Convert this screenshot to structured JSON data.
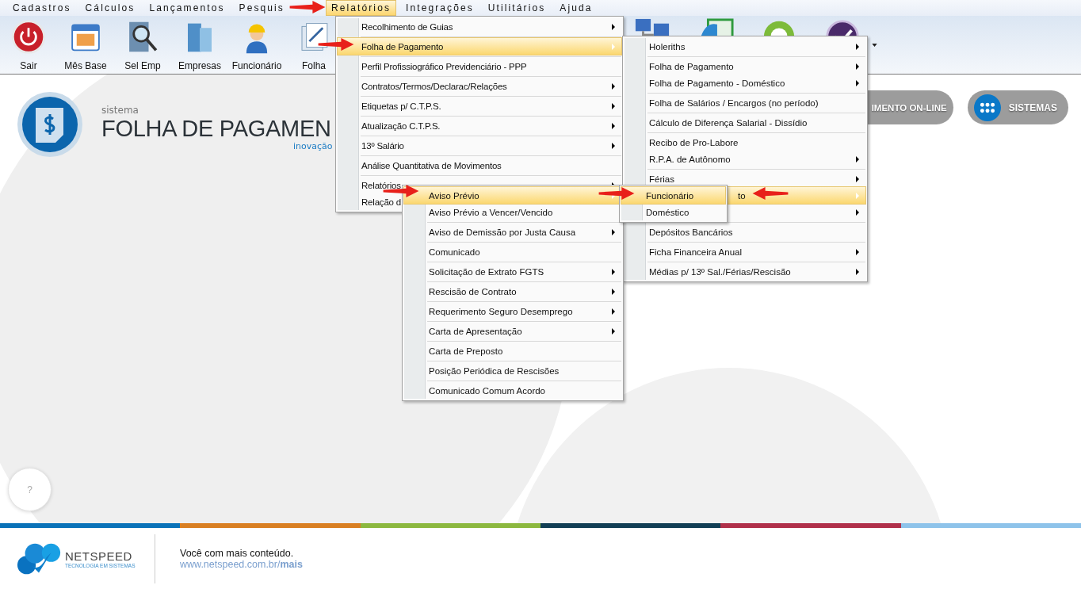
{
  "menu_bar": [
    {
      "label": "Cadastros",
      "selected": false
    },
    {
      "label": "Cálculos",
      "selected": false
    },
    {
      "label": "Lançamentos",
      "selected": false
    },
    {
      "label": "Pesquis",
      "selected": false
    },
    {
      "label": "Relatórios",
      "selected": true
    },
    {
      "label": "Integrações",
      "selected": false
    },
    {
      "label": "Utilitários",
      "selected": false
    },
    {
      "label": "Ajuda",
      "selected": false
    }
  ],
  "toolbar": [
    {
      "label": "Sair"
    },
    {
      "label": "Mês Base"
    },
    {
      "label": "Sel Emp"
    },
    {
      "label": "Empresas"
    },
    {
      "label": "Funcionário"
    },
    {
      "label": "Folha"
    }
  ],
  "logo": {
    "small": "sistema",
    "title": "FOLHA DE PAGAMEN",
    "tagline": "inovação"
  },
  "buttons": [
    {
      "label": "IMENTO ON-LINE",
      "kind": "plain"
    },
    {
      "label": "SISTEMAS",
      "kind": "apps"
    }
  ],
  "help": {
    "label": "?"
  },
  "menus": [
    {
      "items": [
        {
          "label": "Recolhimento de Guias",
          "submenu": true,
          "selected": false,
          "separator": true
        },
        {
          "label": "Folha de Pagamento",
          "submenu": true,
          "selected": true,
          "separator": true
        },
        {
          "label": "Perfil Profissiográfico Previdenciário - PPP",
          "submenu": false,
          "selected": false,
          "separator": true
        },
        {
          "label": "Contratos/Termos/Declarac/Relações",
          "submenu": true,
          "selected": false,
          "separator": true
        },
        {
          "label": "Etiquetas p/ C.T.P.S.",
          "submenu": true,
          "selected": false,
          "separator": true
        },
        {
          "label": "Atualização C.T.P.S.",
          "submenu": true,
          "selected": false,
          "separator": true
        },
        {
          "label": "13º Salário",
          "submenu": true,
          "selected": false,
          "separator": true
        },
        {
          "label": "Análise Quantitativa de Movimentos",
          "submenu": false,
          "selected": false,
          "separator": true
        },
        {
          "label": "Relatórios",
          "submenu": true,
          "selected": false,
          "separator": false
        },
        {
          "label": "Relação d",
          "submenu": false,
          "selected": false,
          "separator": false
        }
      ]
    },
    {
      "items": [
        {
          "label": "Holeriths",
          "submenu": true,
          "selected": false,
          "separator": true,
          "kind": "normal"
        },
        {
          "label": "Folha de Pagamento",
          "submenu": true,
          "selected": false,
          "separator": false,
          "kind": "normal"
        },
        {
          "label": "Folha de Pagamento - Doméstico",
          "submenu": true,
          "selected": false,
          "separator": true,
          "kind": "normal"
        },
        {
          "label": "Folha de Salários / Encargos (no período)",
          "submenu": false,
          "selected": false,
          "separator": true,
          "kind": "normal"
        },
        {
          "label": "Cálculo de Diferença Salarial - Dissídio",
          "submenu": false,
          "selected": false,
          "separator": true,
          "kind": "normal"
        },
        {
          "label": "Recibo de Pro-Labore",
          "submenu": false,
          "selected": false,
          "separator": false,
          "kind": "normal"
        },
        {
          "label": "R.P.A. de Autônomo",
          "submenu": true,
          "selected": false,
          "separator": true,
          "kind": "normal"
        },
        {
          "label": "Férias",
          "submenu": true,
          "selected": false,
          "separator": false,
          "kind": "normal"
        },
        {
          "label": "to",
          "submenu": true,
          "selected": true,
          "separator": false,
          "kind": "partial"
        },
        {
          "submenu": true,
          "selected": false,
          "separator": true,
          "kind": "partial"
        },
        {
          "label": "Depósitos Bancários",
          "submenu": false,
          "selected": false,
          "separator": true,
          "kind": "normal"
        },
        {
          "label": "Ficha Financeira Anual",
          "submenu": true,
          "selected": false,
          "separator": true,
          "kind": "normal"
        },
        {
          "label": "Médias p/ 13º Sal./Férias/Rescisão",
          "submenu": true,
          "selected": false,
          "separator": false,
          "kind": "normal"
        }
      ]
    },
    {
      "items": [
        {
          "label": "Aviso Prévio",
          "submenu": true,
          "selected": true,
          "separator": false
        },
        {
          "label": "Aviso Prévio a Vencer/Vencido",
          "submenu": false,
          "selected": false,
          "separator": true
        },
        {
          "label": "Aviso de Demissão por Justa Causa",
          "submenu": true,
          "selected": false,
          "separator": true
        },
        {
          "label": "Comunicado",
          "submenu": false,
          "selected": false,
          "separator": true
        },
        {
          "label": "Solicitação de Extrato FGTS",
          "submenu": true,
          "selected": false,
          "separator": true
        },
        {
          "label": "Rescisão de Contrato",
          "submenu": true,
          "selected": false,
          "separator": true
        },
        {
          "label": "Requerimento Seguro Desemprego",
          "submenu": true,
          "selected": false,
          "separator": true
        },
        {
          "label": "Carta de Apresentação",
          "submenu": true,
          "selected": false,
          "separator": true
        },
        {
          "label": "Carta de Preposto",
          "submenu": false,
          "selected": false,
          "separator": true
        },
        {
          "label": "Posição Periódica de Rescisões",
          "submenu": false,
          "selected": false,
          "separator": true
        },
        {
          "label": "Comunicado Comum Acordo",
          "submenu": false,
          "selected": false,
          "separator": false
        }
      ]
    },
    {
      "items": [
        {
          "label": "Funcionário",
          "submenu": false,
          "selected": true,
          "separator": false
        },
        {
          "label": "Doméstico",
          "submenu": false,
          "selected": false,
          "separator": false
        }
      ]
    }
  ],
  "footer": {
    "brand": "NETSPEED",
    "brand_tagline": "TECNOLOGIA EM SISTEMAS",
    "message": "Você com mais conteúdo.",
    "link": "www.netspeed.com.br/**mais**"
  }
}
